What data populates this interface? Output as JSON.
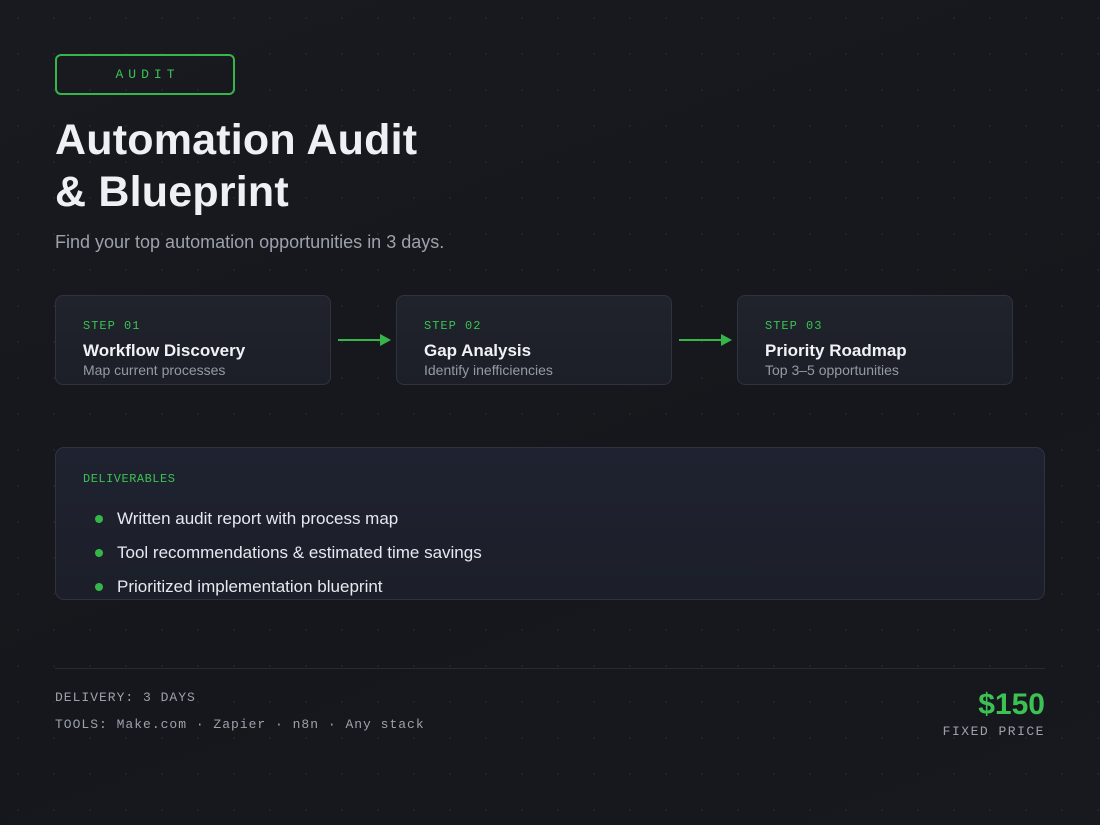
{
  "badge": {
    "label": "AUDIT"
  },
  "header": {
    "title_line1": "Automation Audit",
    "title_line2": "& Blueprint",
    "subtitle": "Find your top automation opportunities in 3 days."
  },
  "steps": [
    {
      "num": "STEP 01",
      "title": "Workflow Discovery",
      "desc": "Map current processes"
    },
    {
      "num": "STEP 02",
      "title": "Gap Analysis",
      "desc": "Identify inefficiencies"
    },
    {
      "num": "STEP 03",
      "title": "Priority Roadmap",
      "desc": "Top 3–5 opportunities"
    }
  ],
  "deliverables": {
    "label": "DELIVERABLES",
    "items": [
      "Written audit report with process map",
      "Tool recommendations & estimated time savings",
      "Prioritized implementation blueprint"
    ]
  },
  "footer": {
    "delivery": "DELIVERY: 3 DAYS",
    "tools": "TOOLS: Make.com · Zapier · n8n · Any stack",
    "price": "$150",
    "price_label": "FIXED PRICE"
  },
  "colors": {
    "accent": "#3cc253",
    "background": "#16181e",
    "card": "#1f2230",
    "border": "#2f3340"
  },
  "icons": {
    "step_connector": "arrow-right-icon",
    "bullet": "dot-icon"
  }
}
